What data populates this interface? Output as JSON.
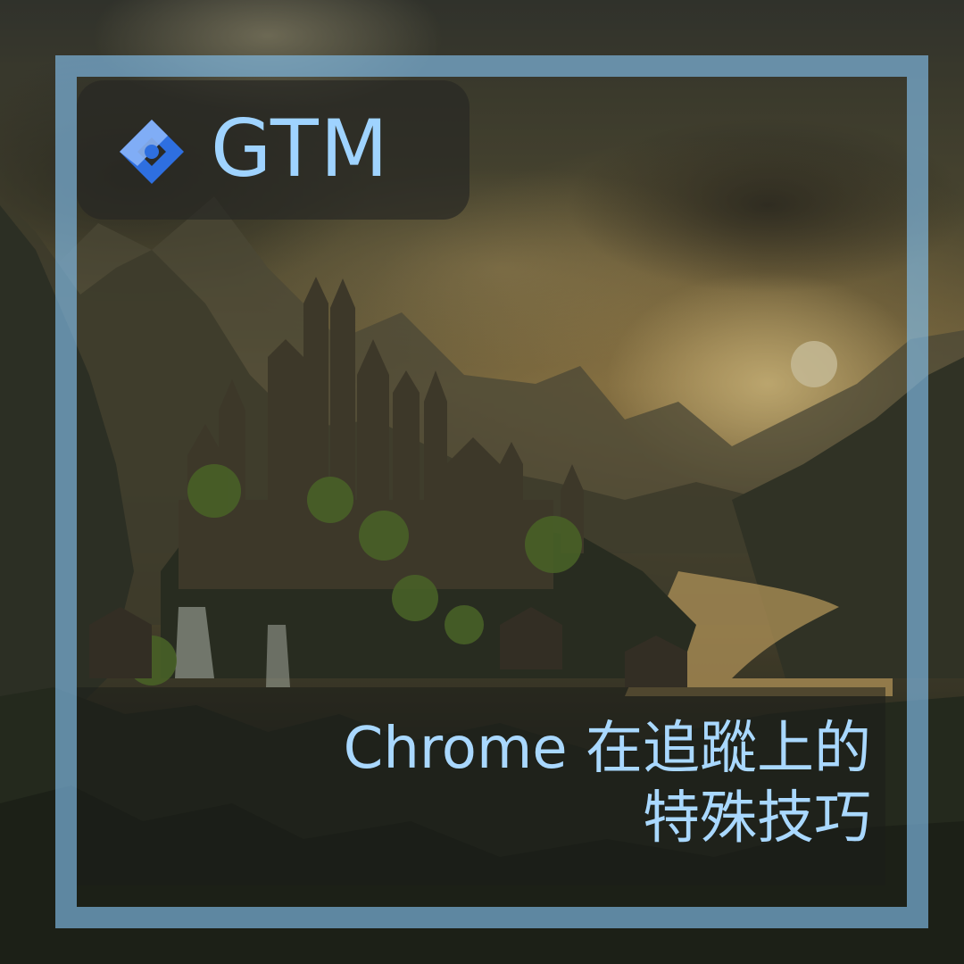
{
  "badge": {
    "logo": "gtm-diamond-icon",
    "text": "GTM"
  },
  "caption": {
    "line1": "Chrome 在追蹤上的",
    "line2": "特殊技巧"
  },
  "colors": {
    "frame": "#82beeb",
    "text": "#a9d8ff",
    "logo_dark": "#2e6fe0",
    "logo_light": "#8ab4f8"
  }
}
